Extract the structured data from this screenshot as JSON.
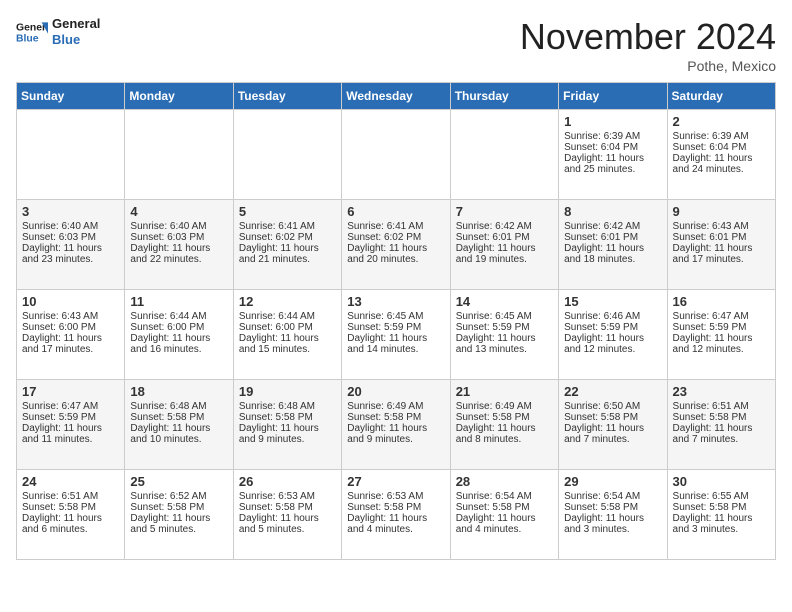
{
  "header": {
    "logo_general": "General",
    "logo_blue": "Blue",
    "month_title": "November 2024",
    "location": "Pothe, Mexico"
  },
  "days_of_week": [
    "Sunday",
    "Monday",
    "Tuesday",
    "Wednesday",
    "Thursday",
    "Friday",
    "Saturday"
  ],
  "weeks": [
    [
      {
        "day": "",
        "empty": true
      },
      {
        "day": "",
        "empty": true
      },
      {
        "day": "",
        "empty": true
      },
      {
        "day": "",
        "empty": true
      },
      {
        "day": "",
        "empty": true
      },
      {
        "day": "1",
        "sunrise": "Sunrise: 6:39 AM",
        "sunset": "Sunset: 6:04 PM",
        "daylight": "Daylight: 11 hours and 25 minutes."
      },
      {
        "day": "2",
        "sunrise": "Sunrise: 6:39 AM",
        "sunset": "Sunset: 6:04 PM",
        "daylight": "Daylight: 11 hours and 24 minutes."
      }
    ],
    [
      {
        "day": "3",
        "sunrise": "Sunrise: 6:40 AM",
        "sunset": "Sunset: 6:03 PM",
        "daylight": "Daylight: 11 hours and 23 minutes."
      },
      {
        "day": "4",
        "sunrise": "Sunrise: 6:40 AM",
        "sunset": "Sunset: 6:03 PM",
        "daylight": "Daylight: 11 hours and 22 minutes."
      },
      {
        "day": "5",
        "sunrise": "Sunrise: 6:41 AM",
        "sunset": "Sunset: 6:02 PM",
        "daylight": "Daylight: 11 hours and 21 minutes."
      },
      {
        "day": "6",
        "sunrise": "Sunrise: 6:41 AM",
        "sunset": "Sunset: 6:02 PM",
        "daylight": "Daylight: 11 hours and 20 minutes."
      },
      {
        "day": "7",
        "sunrise": "Sunrise: 6:42 AM",
        "sunset": "Sunset: 6:01 PM",
        "daylight": "Daylight: 11 hours and 19 minutes."
      },
      {
        "day": "8",
        "sunrise": "Sunrise: 6:42 AM",
        "sunset": "Sunset: 6:01 PM",
        "daylight": "Daylight: 11 hours and 18 minutes."
      },
      {
        "day": "9",
        "sunrise": "Sunrise: 6:43 AM",
        "sunset": "Sunset: 6:01 PM",
        "daylight": "Daylight: 11 hours and 17 minutes."
      }
    ],
    [
      {
        "day": "10",
        "sunrise": "Sunrise: 6:43 AM",
        "sunset": "Sunset: 6:00 PM",
        "daylight": "Daylight: 11 hours and 17 minutes."
      },
      {
        "day": "11",
        "sunrise": "Sunrise: 6:44 AM",
        "sunset": "Sunset: 6:00 PM",
        "daylight": "Daylight: 11 hours and 16 minutes."
      },
      {
        "day": "12",
        "sunrise": "Sunrise: 6:44 AM",
        "sunset": "Sunset: 6:00 PM",
        "daylight": "Daylight: 11 hours and 15 minutes."
      },
      {
        "day": "13",
        "sunrise": "Sunrise: 6:45 AM",
        "sunset": "Sunset: 5:59 PM",
        "daylight": "Daylight: 11 hours and 14 minutes."
      },
      {
        "day": "14",
        "sunrise": "Sunrise: 6:45 AM",
        "sunset": "Sunset: 5:59 PM",
        "daylight": "Daylight: 11 hours and 13 minutes."
      },
      {
        "day": "15",
        "sunrise": "Sunrise: 6:46 AM",
        "sunset": "Sunset: 5:59 PM",
        "daylight": "Daylight: 11 hours and 12 minutes."
      },
      {
        "day": "16",
        "sunrise": "Sunrise: 6:47 AM",
        "sunset": "Sunset: 5:59 PM",
        "daylight": "Daylight: 11 hours and 12 minutes."
      }
    ],
    [
      {
        "day": "17",
        "sunrise": "Sunrise: 6:47 AM",
        "sunset": "Sunset: 5:59 PM",
        "daylight": "Daylight: 11 hours and 11 minutes."
      },
      {
        "day": "18",
        "sunrise": "Sunrise: 6:48 AM",
        "sunset": "Sunset: 5:58 PM",
        "daylight": "Daylight: 11 hours and 10 minutes."
      },
      {
        "day": "19",
        "sunrise": "Sunrise: 6:48 AM",
        "sunset": "Sunset: 5:58 PM",
        "daylight": "Daylight: 11 hours and 9 minutes."
      },
      {
        "day": "20",
        "sunrise": "Sunrise: 6:49 AM",
        "sunset": "Sunset: 5:58 PM",
        "daylight": "Daylight: 11 hours and 9 minutes."
      },
      {
        "day": "21",
        "sunrise": "Sunrise: 6:49 AM",
        "sunset": "Sunset: 5:58 PM",
        "daylight": "Daylight: 11 hours and 8 minutes."
      },
      {
        "day": "22",
        "sunrise": "Sunrise: 6:50 AM",
        "sunset": "Sunset: 5:58 PM",
        "daylight": "Daylight: 11 hours and 7 minutes."
      },
      {
        "day": "23",
        "sunrise": "Sunrise: 6:51 AM",
        "sunset": "Sunset: 5:58 PM",
        "daylight": "Daylight: 11 hours and 7 minutes."
      }
    ],
    [
      {
        "day": "24",
        "sunrise": "Sunrise: 6:51 AM",
        "sunset": "Sunset: 5:58 PM",
        "daylight": "Daylight: 11 hours and 6 minutes."
      },
      {
        "day": "25",
        "sunrise": "Sunrise: 6:52 AM",
        "sunset": "Sunset: 5:58 PM",
        "daylight": "Daylight: 11 hours and 5 minutes."
      },
      {
        "day": "26",
        "sunrise": "Sunrise: 6:53 AM",
        "sunset": "Sunset: 5:58 PM",
        "daylight": "Daylight: 11 hours and 5 minutes."
      },
      {
        "day": "27",
        "sunrise": "Sunrise: 6:53 AM",
        "sunset": "Sunset: 5:58 PM",
        "daylight": "Daylight: 11 hours and 4 minutes."
      },
      {
        "day": "28",
        "sunrise": "Sunrise: 6:54 AM",
        "sunset": "Sunset: 5:58 PM",
        "daylight": "Daylight: 11 hours and 4 minutes."
      },
      {
        "day": "29",
        "sunrise": "Sunrise: 6:54 AM",
        "sunset": "Sunset: 5:58 PM",
        "daylight": "Daylight: 11 hours and 3 minutes."
      },
      {
        "day": "30",
        "sunrise": "Sunrise: 6:55 AM",
        "sunset": "Sunset: 5:58 PM",
        "daylight": "Daylight: 11 hours and 3 minutes."
      }
    ]
  ]
}
